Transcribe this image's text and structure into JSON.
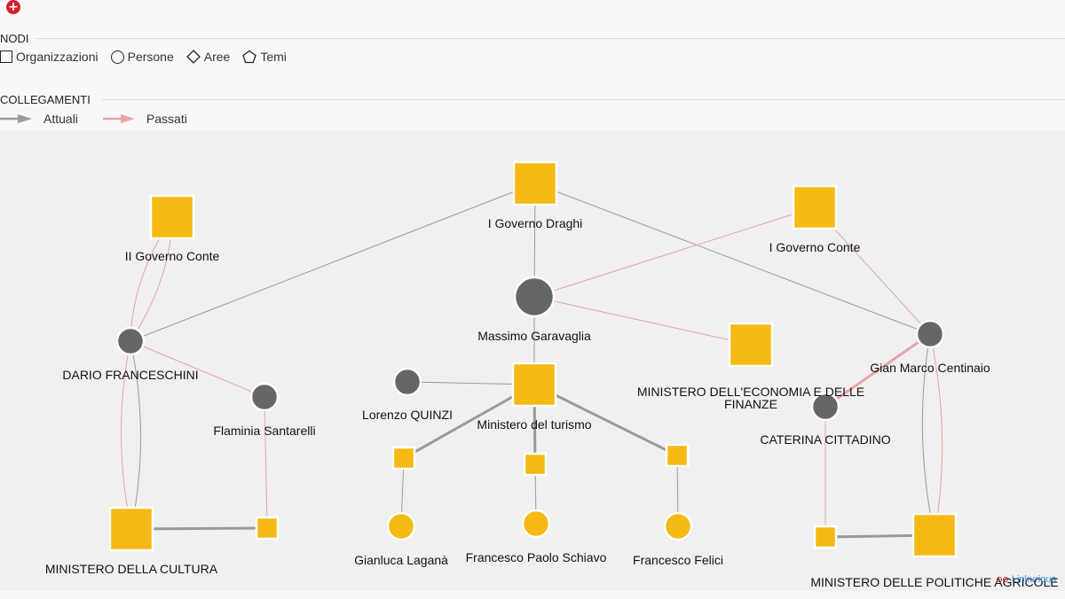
{
  "toolbar": {
    "add_icon": "plus-circle-icon"
  },
  "legend": {
    "nodes_title": "NODI",
    "node_types": [
      {
        "label": "Organizzazioni",
        "icon": "square-icon"
      },
      {
        "label": "Persone",
        "icon": "circle-icon"
      },
      {
        "label": "Aree",
        "icon": "diamond-icon"
      },
      {
        "label": "Temi",
        "icon": "pentagon-icon"
      }
    ],
    "links_title": "COLLEGAMENTI",
    "link_types": [
      {
        "label": "Attuali",
        "color": "#8f8f8f"
      },
      {
        "label": "Passati",
        "color": "#e8a4a4"
      }
    ]
  },
  "colors": {
    "organization": "#f5b914",
    "person": "#666666",
    "current_link": "#9a9a9a",
    "past_link": "#e8a4a4"
  },
  "graph": {
    "nodes": [
      {
        "id": "draghi",
        "label": "I Governo Draghi",
        "kind": "org",
        "size": "large"
      },
      {
        "id": "conte1",
        "label": "I Governo Conte",
        "kind": "org",
        "size": "large"
      },
      {
        "id": "conte2",
        "label": "II Governo Conte",
        "kind": "org",
        "size": "large"
      },
      {
        "id": "garavaglia",
        "label": "Massimo Garavaglia",
        "kind": "person",
        "size": "large"
      },
      {
        "id": "mef",
        "label": "MINISTERO DELL'ECONOMIA E DELLE FINANZE",
        "kind": "org",
        "size": "large"
      },
      {
        "id": "franceschini",
        "label": "DARIO FRANCESCHINI",
        "kind": "person",
        "size": "medium"
      },
      {
        "id": "santarelli",
        "label": "Flaminia Santarelli",
        "kind": "person",
        "size": "medium"
      },
      {
        "id": "centinaio",
        "label": "Gian Marco Centinaio",
        "kind": "person",
        "size": "medium"
      },
      {
        "id": "cittadino",
        "label": "CATERINA CITTADINO",
        "kind": "person",
        "size": "medium"
      },
      {
        "id": "quinzi",
        "label": "Lorenzo QUINZI",
        "kind": "person",
        "size": "medium"
      },
      {
        "id": "turismo",
        "label": "Ministero del turismo",
        "kind": "org",
        "size": "large"
      },
      {
        "id": "t_left",
        "label": "",
        "kind": "org",
        "size": "small"
      },
      {
        "id": "t_mid",
        "label": "",
        "kind": "org",
        "size": "small"
      },
      {
        "id": "t_right",
        "label": "",
        "kind": "org",
        "size": "small"
      },
      {
        "id": "lagana",
        "label": "Gianluca Laganà",
        "kind": "person-yellow",
        "size": "medium"
      },
      {
        "id": "schiavo",
        "label": "Francesco Paolo Schiavo",
        "kind": "person-yellow",
        "size": "medium"
      },
      {
        "id": "felici",
        "label": "Francesco Felici",
        "kind": "person-yellow",
        "size": "medium"
      },
      {
        "id": "cultura",
        "label": "MINISTERO DELLA CULTURA",
        "kind": "org",
        "size": "large"
      },
      {
        "id": "c_small",
        "label": "",
        "kind": "org",
        "size": "small"
      },
      {
        "id": "agricole",
        "label": "MINISTERO DELLE POLITICHE AGRICOLE",
        "kind": "org",
        "size": "large"
      },
      {
        "id": "a_small",
        "label": "",
        "kind": "org",
        "size": "small"
      }
    ],
    "edges": [
      {
        "from": "draghi",
        "to": "garavaglia",
        "type": "current"
      },
      {
        "from": "draghi",
        "to": "franceschini",
        "type": "current"
      },
      {
        "from": "draghi",
        "to": "centinaio",
        "type": "current"
      },
      {
        "from": "conte1",
        "to": "garavaglia",
        "type": "past"
      },
      {
        "from": "conte1",
        "to": "centinaio",
        "type": "past"
      },
      {
        "from": "garavaglia",
        "to": "mef",
        "type": "past"
      },
      {
        "from": "garavaglia",
        "to": "turismo",
        "type": "current"
      },
      {
        "from": "conte2",
        "to": "franceschini",
        "type": "past",
        "curve": "a"
      },
      {
        "from": "conte2",
        "to": "franceschini",
        "type": "past",
        "curve": "b"
      },
      {
        "from": "franceschini",
        "to": "santarelli",
        "type": "past"
      },
      {
        "from": "franceschini",
        "to": "cultura",
        "type": "past",
        "curve": "left"
      },
      {
        "from": "franceschini",
        "to": "cultura",
        "type": "current",
        "curve": "right"
      },
      {
        "from": "santarelli",
        "to": "c_small",
        "type": "past"
      },
      {
        "from": "cultura",
        "to": "c_small",
        "type": "current-strong"
      },
      {
        "from": "quinzi",
        "to": "turismo",
        "type": "current"
      },
      {
        "from": "turismo",
        "to": "t_left",
        "type": "current-strong"
      },
      {
        "from": "turismo",
        "to": "t_mid",
        "type": "current-strong"
      },
      {
        "from": "turismo",
        "to": "t_right",
        "type": "current-strong"
      },
      {
        "from": "t_left",
        "to": "lagana",
        "type": "current"
      },
      {
        "from": "t_mid",
        "to": "schiavo",
        "type": "current"
      },
      {
        "from": "t_right",
        "to": "felici",
        "type": "current"
      },
      {
        "from": "centinaio",
        "to": "cittadino",
        "type": "past-strong"
      },
      {
        "from": "cittadino",
        "to": "a_small",
        "type": "past"
      },
      {
        "from": "a_small",
        "to": "agricole",
        "type": "current-strong"
      },
      {
        "from": "centinaio",
        "to": "agricole",
        "type": "current",
        "curve": "left"
      },
      {
        "from": "centinaio",
        "to": "agricole",
        "type": "past",
        "curve": "right"
      }
    ]
  },
  "brand": {
    "label": "Linkurious"
  }
}
